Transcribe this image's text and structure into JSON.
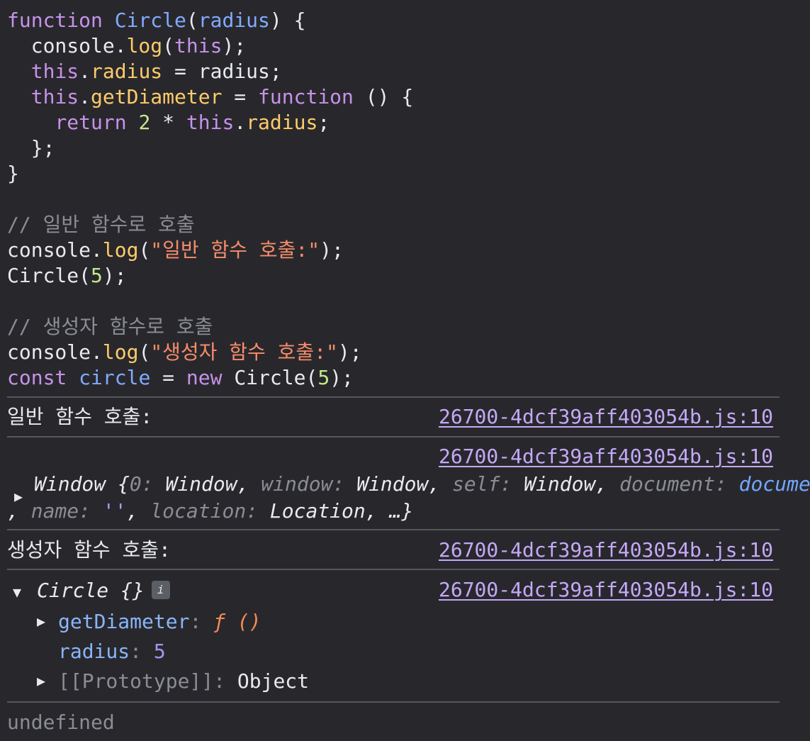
{
  "code": {
    "l1": {
      "kw": "function",
      "name": "Circle",
      "open": "(",
      "param": "radius",
      "close": ") {"
    },
    "l2": {
      "pre": "  console.",
      "call": "log",
      "open": "(",
      "arg": "this",
      "close": ");"
    },
    "l3": {
      "kw": "this",
      "dot": ".",
      "prop": "radius",
      "rest": " = radius;"
    },
    "l4": {
      "kw": "this",
      "dot": ".",
      "prop": "getDiameter",
      "eq": " = ",
      "kw2": "function",
      "rest": " () {"
    },
    "l5": {
      "kw": "return",
      "num": "2",
      "star": " * ",
      "kw2": "this",
      "dot": ".",
      "prop": "radius",
      "semi": ";"
    },
    "l6": "  };",
    "l7": "}",
    "c1": "// 일반 함수로 호출",
    "l8": {
      "pre": "console.",
      "call": "log",
      "open": "(",
      "str": "\"일반 함수 호출:\"",
      "close": ");"
    },
    "l9": {
      "pre": "Circle(",
      "num": "5",
      "close": ");"
    },
    "c2": "// 생성자 함수로 호출",
    "l10": {
      "pre": "console.",
      "call": "log",
      "open": "(",
      "str": "\"생성자 함수 호출:\"",
      "close": ");"
    },
    "l11": {
      "kw": "const",
      "var": "circle",
      "eq": " = ",
      "kw2": "new",
      "pre": " Circle(",
      "num": "5",
      "close": ");"
    }
  },
  "output": {
    "msg1": "일반 함수 호출:",
    "source": "26700-4dcf39aff403054b.js:10",
    "window_line1": {
      "head": "Window {",
      "k0": "0",
      "v0": "Window",
      "k1": "window",
      "v1": "Window",
      "k2": "self",
      "v2": "Window",
      "k3": "document",
      "v3": "document"
    },
    "window_line2": {
      "k4": "name",
      "v4": "''",
      "k5": "location",
      "v5": "Location",
      "tail": ", …}"
    },
    "msg2": "생성자 함수 호출:",
    "circle": {
      "head": "Circle {}",
      "badge": "i",
      "props": [
        {
          "name": "getDiameter",
          "value": "ƒ ()"
        },
        {
          "name": "radius",
          "value": "5"
        },
        {
          "name": "[[Prototype]]",
          "value": "Object"
        }
      ]
    },
    "result": "undefined"
  },
  "colors": {
    "background": "#28282c",
    "keyword": "#c792ea",
    "string": "#f78c6c",
    "link": "#c5a8f8"
  }
}
